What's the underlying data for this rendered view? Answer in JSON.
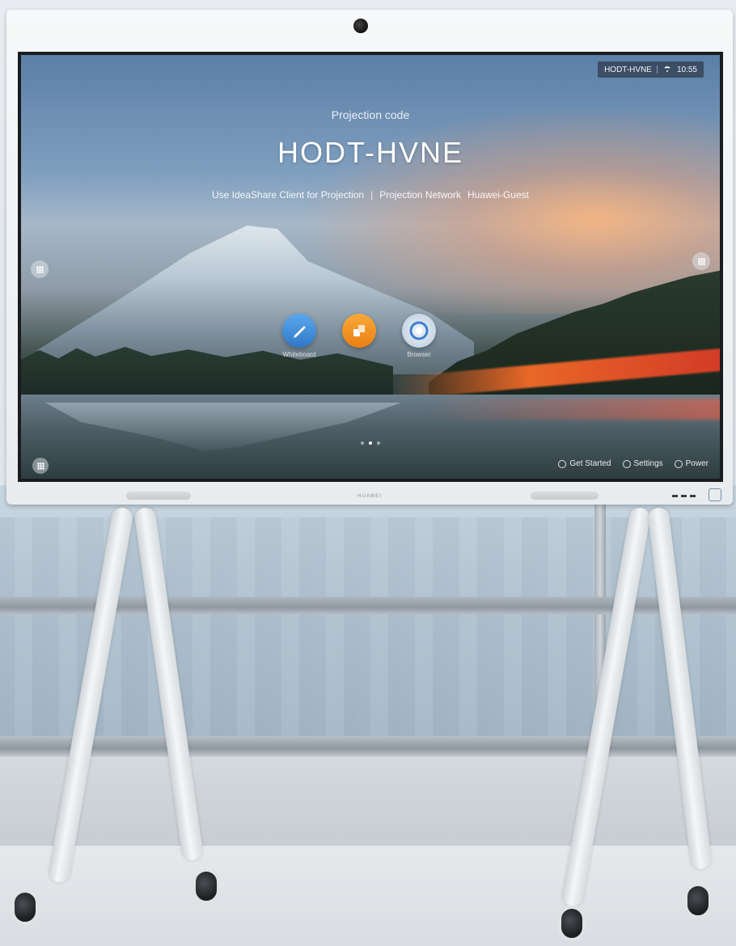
{
  "status_bar": {
    "code": "HODT-HVNE",
    "time": "10:55"
  },
  "home": {
    "projection_label": "Projection code",
    "projection_code": "HODT-HVNE",
    "client_hint": "Use IdeaShare Client for Projection",
    "network_label": "Projection Network",
    "network_name": "Huawei-Guest"
  },
  "apps": [
    {
      "label": "Whiteboard",
      "icon": "pen-icon",
      "color": "#3f8fd8"
    },
    {
      "label": "",
      "icon": "files-icon",
      "color": "#f2951f"
    },
    {
      "label": "Browser",
      "icon": "browser-icon",
      "color": "#d7e2ee"
    }
  ],
  "actions": {
    "get_started": "Get Started",
    "settings": "Settings",
    "power": "Power"
  },
  "pager": {
    "pages": 3,
    "active": 2
  },
  "brand": "HUAWEI"
}
